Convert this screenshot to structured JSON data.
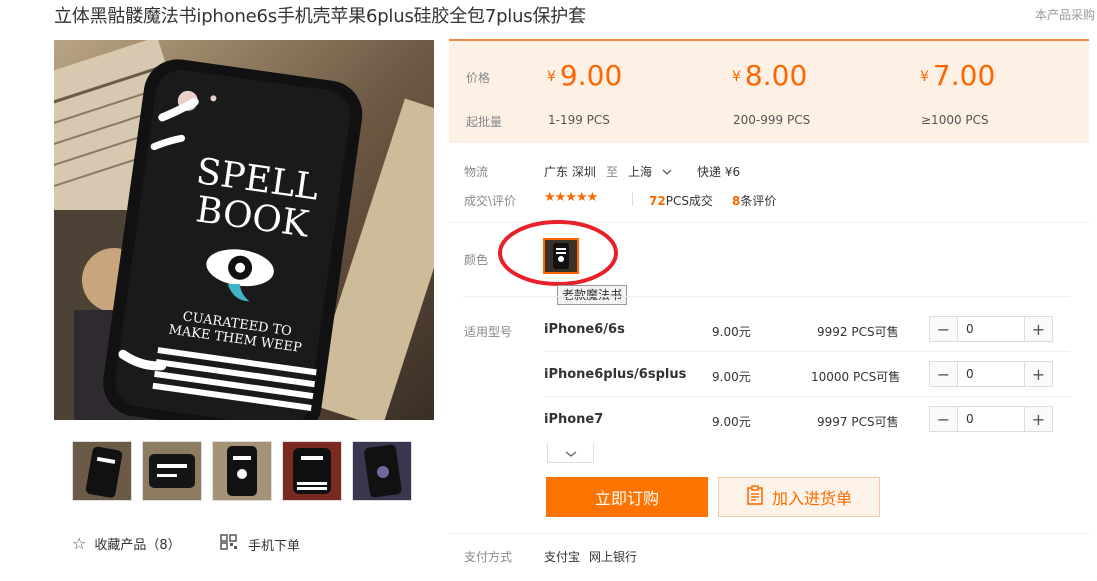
{
  "product": {
    "title": "立体黑骷髅魔法书iphone6s手机壳苹果6plus硅胶全包7plus保护套",
    "note": "本产品采购"
  },
  "book_text": {
    "spell": "SPELL",
    "book": "BOOK",
    "line1": "CUARATEED TO",
    "line2": "MAKE THEM WEEP"
  },
  "price_section": {
    "price_label": "价格",
    "moq_label": "起批量",
    "currency": "¥",
    "tiers": [
      {
        "price": "9.00",
        "range": "1-199 PCS"
      },
      {
        "price": "8.00",
        "range": "200-999 PCS"
      },
      {
        "price": "7.00",
        "range": "≥1000 PCS"
      }
    ]
  },
  "logistics": {
    "label": "物流",
    "from": "广东 深圳",
    "to_word": "至",
    "to": "上海",
    "express": "快递 ¥6"
  },
  "rating": {
    "label": "成交\\评价",
    "stars": "★★★★★",
    "deals_num": "72",
    "deals_text": "PCS成交",
    "reviews_num": "8",
    "reviews_text": "条评价"
  },
  "color": {
    "label": "颜色",
    "tooltip": "老款魔法书"
  },
  "models": {
    "label": "适用型号",
    "items": [
      {
        "name": "iPhone6/6s",
        "price": "9.00元",
        "stock": "9992 PCS可售",
        "qty": "0"
      },
      {
        "name": "iPhone6plus/6splus",
        "price": "9.00元",
        "stock": "10000 PCS可售",
        "qty": "0"
      },
      {
        "name": "iPhone7",
        "price": "9.00元",
        "stock": "9997 PCS可售",
        "qty": "0"
      }
    ]
  },
  "actions": {
    "buy": "立即订购",
    "cart": "加入进货单",
    "collect": "收藏产品（8）",
    "mobile_order": "手机下单"
  },
  "payment": {
    "label": "支付方式",
    "method1": "支付宝",
    "method2": "网上银行"
  },
  "colors": {
    "accent": "#ff6600",
    "price_bg": "#fdf1e6",
    "highlight_circle": "#e8202a"
  }
}
